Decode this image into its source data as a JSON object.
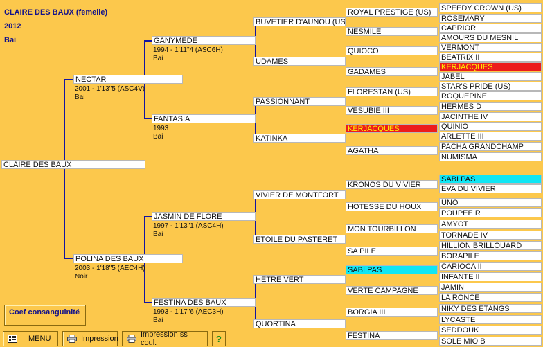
{
  "header": {
    "name": "CLAIRE DES BAUX  (femelle)",
    "year": "2012",
    "coat": "Bai"
  },
  "subject": "CLAIRE DES BAUX",
  "gen1": [
    {
      "name": "NECTAR",
      "info1": "2001 -  1'13\"5 (ASC4V)",
      "info2": "Bai"
    },
    {
      "name": "POLINA DES BAUX",
      "info1": "2003 -  1'18\"5 (AEC4H)",
      "info2": "Noir"
    }
  ],
  "gen2": [
    {
      "name": "GANYMEDE",
      "info1": "1994 -  1'11\"4 (ASC6H)",
      "info2": "Bai"
    },
    {
      "name": "FANTASIA",
      "info1": "1993",
      "info2": "Bai"
    },
    {
      "name": "JASMIN DE FLORE",
      "info1": "1997 -  1'13\"1 (ASC4H)",
      "info2": "Bai"
    },
    {
      "name": "FESTINA DES BAUX",
      "info1": "1993 -  1'17\"6 (AEC3H)",
      "info2": "Bai"
    }
  ],
  "gen3": [
    "BUVETIER D'AUNOU (US)",
    "UDAMES",
    "PASSIONNANT",
    "KATINKA",
    "VIVIER DE MONTFORT",
    "ETOILE DU PASTERET",
    "HETRE VERT",
    "QUORTINA"
  ],
  "gen4": [
    "ROYAL PRESTIGE (US)",
    "NESMILE",
    "QUIOCO",
    "GADAMES",
    "FLORESTAN (US)",
    "VESUBIE III",
    "KERJACQUES",
    "AGATHA",
    "KRONOS DU VIVIER",
    "HOTESSE DU HOUX",
    "MON TOURBILLON",
    "SA PILE",
    "SABI PAS",
    "VERTE CAMPAGNE",
    "BORGIA III",
    "FESTINA"
  ],
  "gen5": [
    "SPEEDY CROWN (US)",
    "ROSEMARY",
    "CAPRIOR",
    "AMOURS DU MESNIL",
    "VERMONT",
    "BEATRIX II",
    "KERJACQUES",
    "JABEL",
    "STAR'S PRIDE (US)",
    "ROQUEPINE",
    "HERMES D",
    "JACINTHE IV",
    "QUINIO",
    "ARLETTE III",
    "PACHA GRANDCHAMP",
    "NUMISMA",
    "SABI PAS",
    "EVA DU VIVIER",
    "UNO",
    "POUPEE R",
    "AMYOT",
    "TORNADE IV",
    "HILLION BRILLOUARD",
    "BORAPILE",
    "CARIOCA II",
    "INFANTE II",
    "JAMIN",
    "LA RONCE",
    "NIKY DES ETANGS",
    "LYCASTE",
    "SEDDOUK",
    "SOLE MIO B"
  ],
  "highlight_colors": {
    "red": "#ec1c1c",
    "cyan": "#10e6f4",
    "line": "#1414a0",
    "background": "#fcc84c"
  },
  "buttons": {
    "coef": "Coef consanguinité",
    "menu": "MENU",
    "print": "Impression",
    "print_nocolor": "Impression ss coul.",
    "help": "?"
  },
  "icons": {
    "menu": "menu-grid-icon",
    "print": "printer-icon",
    "help": "help-icon"
  }
}
